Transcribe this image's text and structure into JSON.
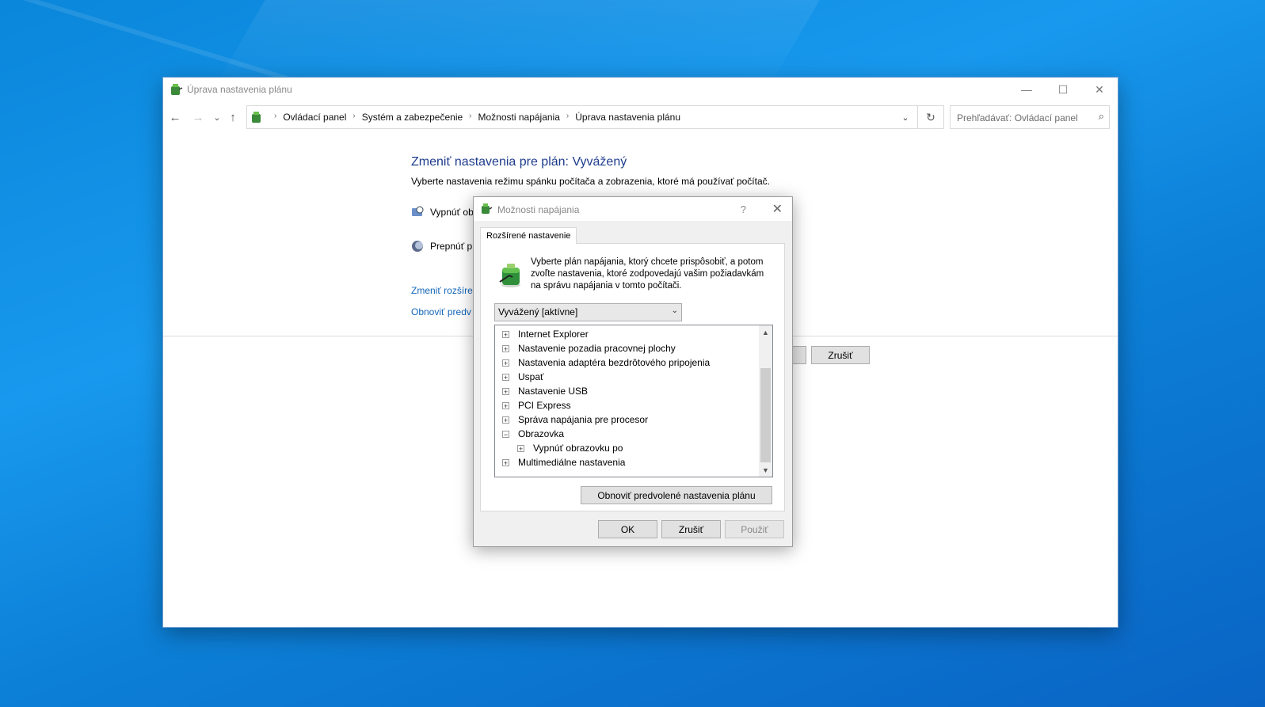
{
  "window": {
    "title": "Úprava nastavenia plánu",
    "minimize": "—",
    "maximize": "☐",
    "close": "✕"
  },
  "nav": {
    "back": "←",
    "forward": "→",
    "recent": "⌄",
    "up": "↑",
    "breadcrumbs": [
      "Ovládací panel",
      "Systém a zabezpečenie",
      "Možnosti napájania",
      "Úprava nastavenia plánu"
    ],
    "separator": "›",
    "dropdown": "⌄",
    "refresh": "↻",
    "search_placeholder": "Prehľadávať: Ovládací panel",
    "search_icon": "⌕"
  },
  "main": {
    "heading": "Zmeniť nastavenia pre plán: Vyvážený",
    "subtext": "Vyberte nastavenia režimu spánku počítača a zobrazenia, ktoré má používať počítač.",
    "rows": [
      "Vypnúť ob",
      "Prepnúť p"
    ],
    "links": [
      "Zmeniť rozšíre",
      "Obnoviť predv"
    ],
    "cancel": "Zrušiť"
  },
  "dialog": {
    "title": "Možnosti napájania",
    "help": "?",
    "close": "✕",
    "tab": "Rozšírené nastavenie",
    "description": "Vyberte plán napájania, ktorý chcete prispôsobiť, a potom zvoľte nastavenia, ktoré zodpovedajú vašim požiadavkám na správu napájania v tomto počítači.",
    "plan_select": "Vyvážený [aktívne]",
    "tree": [
      {
        "label": "Internet Explorer",
        "exp": "+",
        "level": 0
      },
      {
        "label": "Nastavenie pozadia pracovnej plochy",
        "exp": "+",
        "level": 0
      },
      {
        "label": "Nastavenia adaptéra bezdrôtového pripojenia",
        "exp": "+",
        "level": 0
      },
      {
        "label": "Uspať",
        "exp": "+",
        "level": 0
      },
      {
        "label": "Nastavenie USB",
        "exp": "+",
        "level": 0
      },
      {
        "label": "PCI Express",
        "exp": "+",
        "level": 0
      },
      {
        "label": "Správa napájania pre procesor",
        "exp": "+",
        "level": 0
      },
      {
        "label": "Obrazovka",
        "exp": "−",
        "level": 0
      },
      {
        "label": "Vypnúť obrazovku po",
        "exp": "+",
        "level": 1
      },
      {
        "label": "Multimediálne nastavenia",
        "exp": "+",
        "level": 0
      }
    ],
    "restore_button": "Obnoviť predvolené nastavenia plánu",
    "ok": "OK",
    "cancel": "Zrušiť",
    "apply": "Použiť"
  },
  "colors": {
    "heading": "#1e3c8c",
    "link": "#1466b8",
    "desktop": "#0a86da"
  }
}
